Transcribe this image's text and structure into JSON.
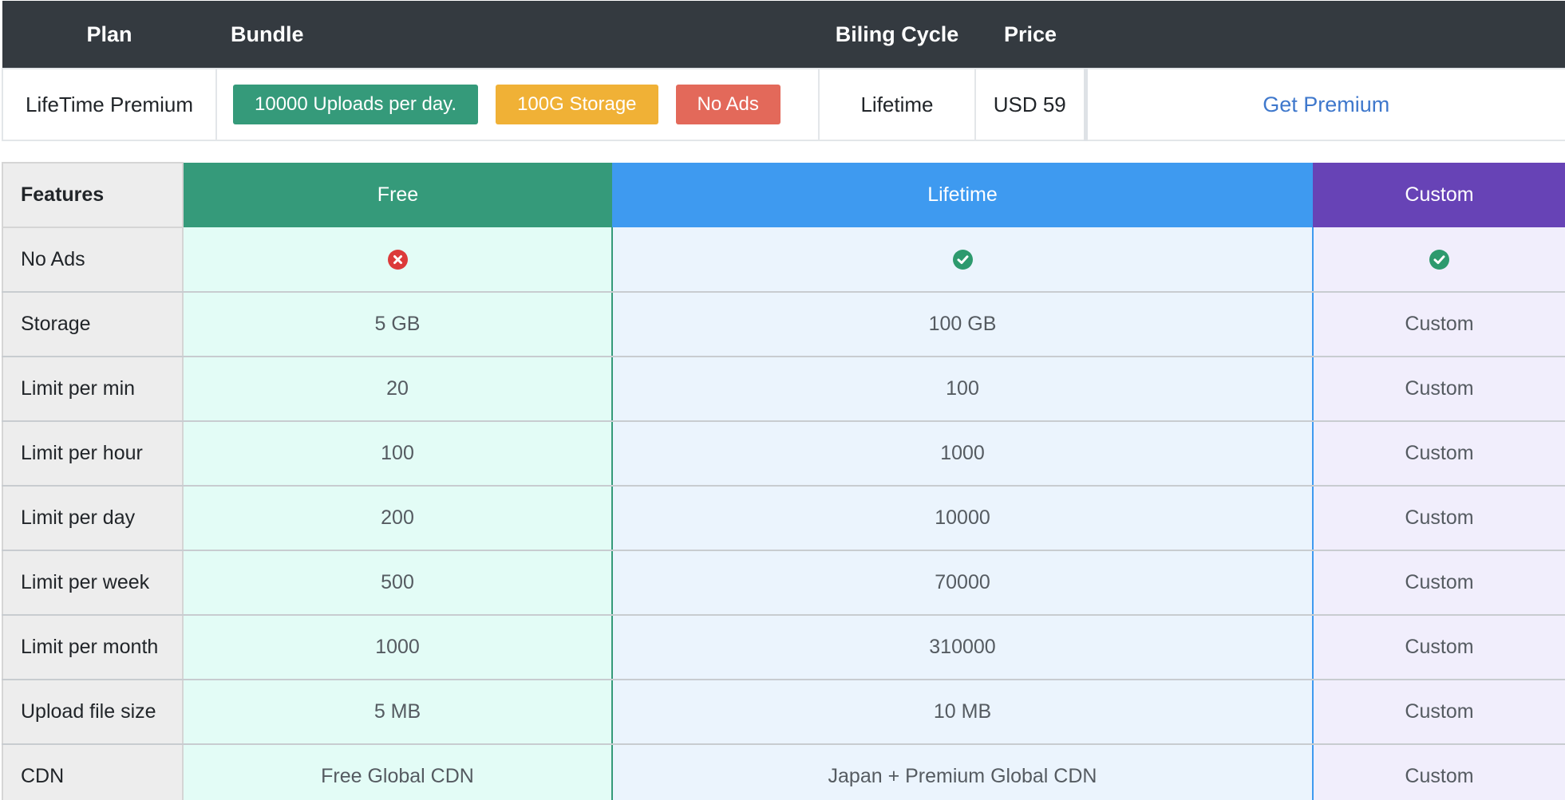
{
  "plan_table": {
    "headers": {
      "plan": "Plan",
      "bundle": "Bundle",
      "billing_cycle": "Biling Cycle",
      "price": "Price",
      "action": ""
    },
    "row": {
      "plan": "LifeTime Premium",
      "badges": [
        {
          "label": "10000 Uploads per day.",
          "color": "#359a7a"
        },
        {
          "label": "100G Storage",
          "color": "#f0b136"
        },
        {
          "label": "No Ads",
          "color": "#e3695a"
        }
      ],
      "billing_cycle": "Lifetime",
      "price": "USD 59",
      "action_label": "Get Premium"
    }
  },
  "features_table": {
    "headers": {
      "features": "Features",
      "free": "Free",
      "lifetime": "Lifetime",
      "custom": "Custom"
    },
    "colors": {
      "free": "#359a7a",
      "lifetime": "#3e9af0",
      "custom": "#6743b6"
    },
    "rows": [
      {
        "feature": "No Ads",
        "free_icon": "x-circle-icon",
        "lifetime_icon": "check-circle-icon",
        "custom_icon": "check-circle-icon"
      },
      {
        "feature": "Storage",
        "free": "5 GB",
        "lifetime": "100 GB",
        "custom": "Custom"
      },
      {
        "feature": "Limit per min",
        "free": "20",
        "lifetime": "100",
        "custom": "Custom"
      },
      {
        "feature": "Limit per hour",
        "free": "100",
        "lifetime": "1000",
        "custom": "Custom"
      },
      {
        "feature": "Limit per day",
        "free": "200",
        "lifetime": "10000",
        "custom": "Custom"
      },
      {
        "feature": "Limit per week",
        "free": "500",
        "lifetime": "70000",
        "custom": "Custom"
      },
      {
        "feature": "Limit per month",
        "free": "1000",
        "lifetime": "310000",
        "custom": "Custom"
      },
      {
        "feature": "Upload file size",
        "free": "5 MB",
        "lifetime": "10 MB",
        "custom": "Custom"
      },
      {
        "feature": "CDN",
        "free": "Free Global CDN",
        "lifetime": "Japan + Premium Global CDN",
        "custom": "Custom"
      }
    ]
  }
}
